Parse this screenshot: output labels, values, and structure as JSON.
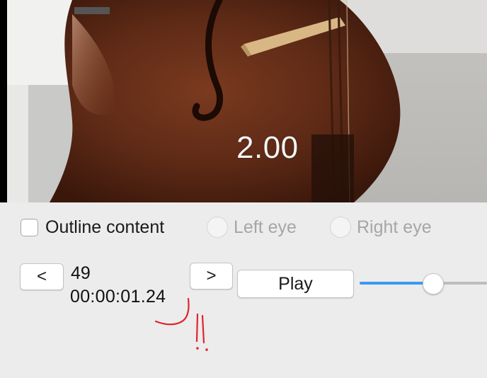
{
  "video": {
    "overlay_label": "2.00"
  },
  "options": {
    "outline_label": "Outline content",
    "outline_checked": false,
    "left_eye_label": "Left eye",
    "right_eye_label": "Right eye"
  },
  "controls": {
    "prev_label": "<",
    "next_label": ">",
    "frame_number": "49",
    "timecode": "00:00:01.24",
    "play_label": "Play"
  },
  "slider": {
    "value_fraction": 0.58
  },
  "colors": {
    "accent": "#3b99f0",
    "background": "#ececec",
    "annotation": "#e0252b"
  }
}
